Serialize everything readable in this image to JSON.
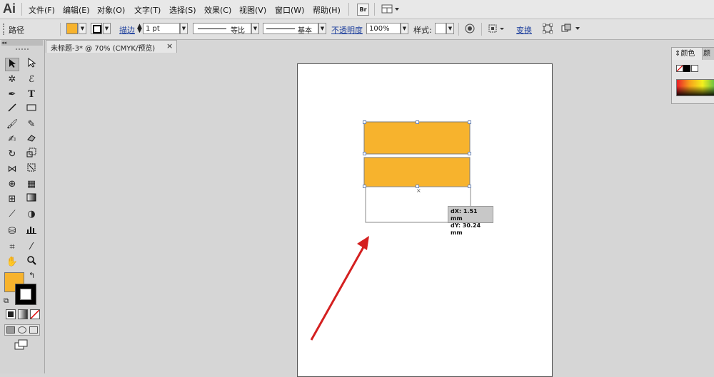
{
  "app": {
    "logo": "Ai"
  },
  "menu": [
    "文件(F)",
    "编辑(E)",
    "对象(O)",
    "文字(T)",
    "选择(S)",
    "效果(C)",
    "视图(V)",
    "窗口(W)",
    "帮助(H)"
  ],
  "menu_right": {
    "bridge": "Br"
  },
  "control": {
    "object_type": "路径",
    "fill_color": "#f7b32d",
    "stroke_label": "描边",
    "stroke_weight": "1 pt",
    "profile_label": "等比",
    "brush_label": "基本",
    "opacity_label": "不透明度",
    "opacity_value": "100%",
    "style_label": "样式:",
    "transform_label": "变换"
  },
  "document": {
    "tab_title": "未标题-3* @ 70% (CMYK/预览)",
    "close": "×"
  },
  "canvas": {
    "shape_color": "#f7b32d",
    "readout": {
      "dx": "dX: 1.51 mm",
      "dy": "dY: 30.24 mm"
    },
    "arrow_color": "#d42020"
  },
  "tools": {
    "fill_color": "#f7b32d",
    "stroke_color": "#000000"
  },
  "color_panel": {
    "tab1": "颜色",
    "tab2": "颜参"
  }
}
